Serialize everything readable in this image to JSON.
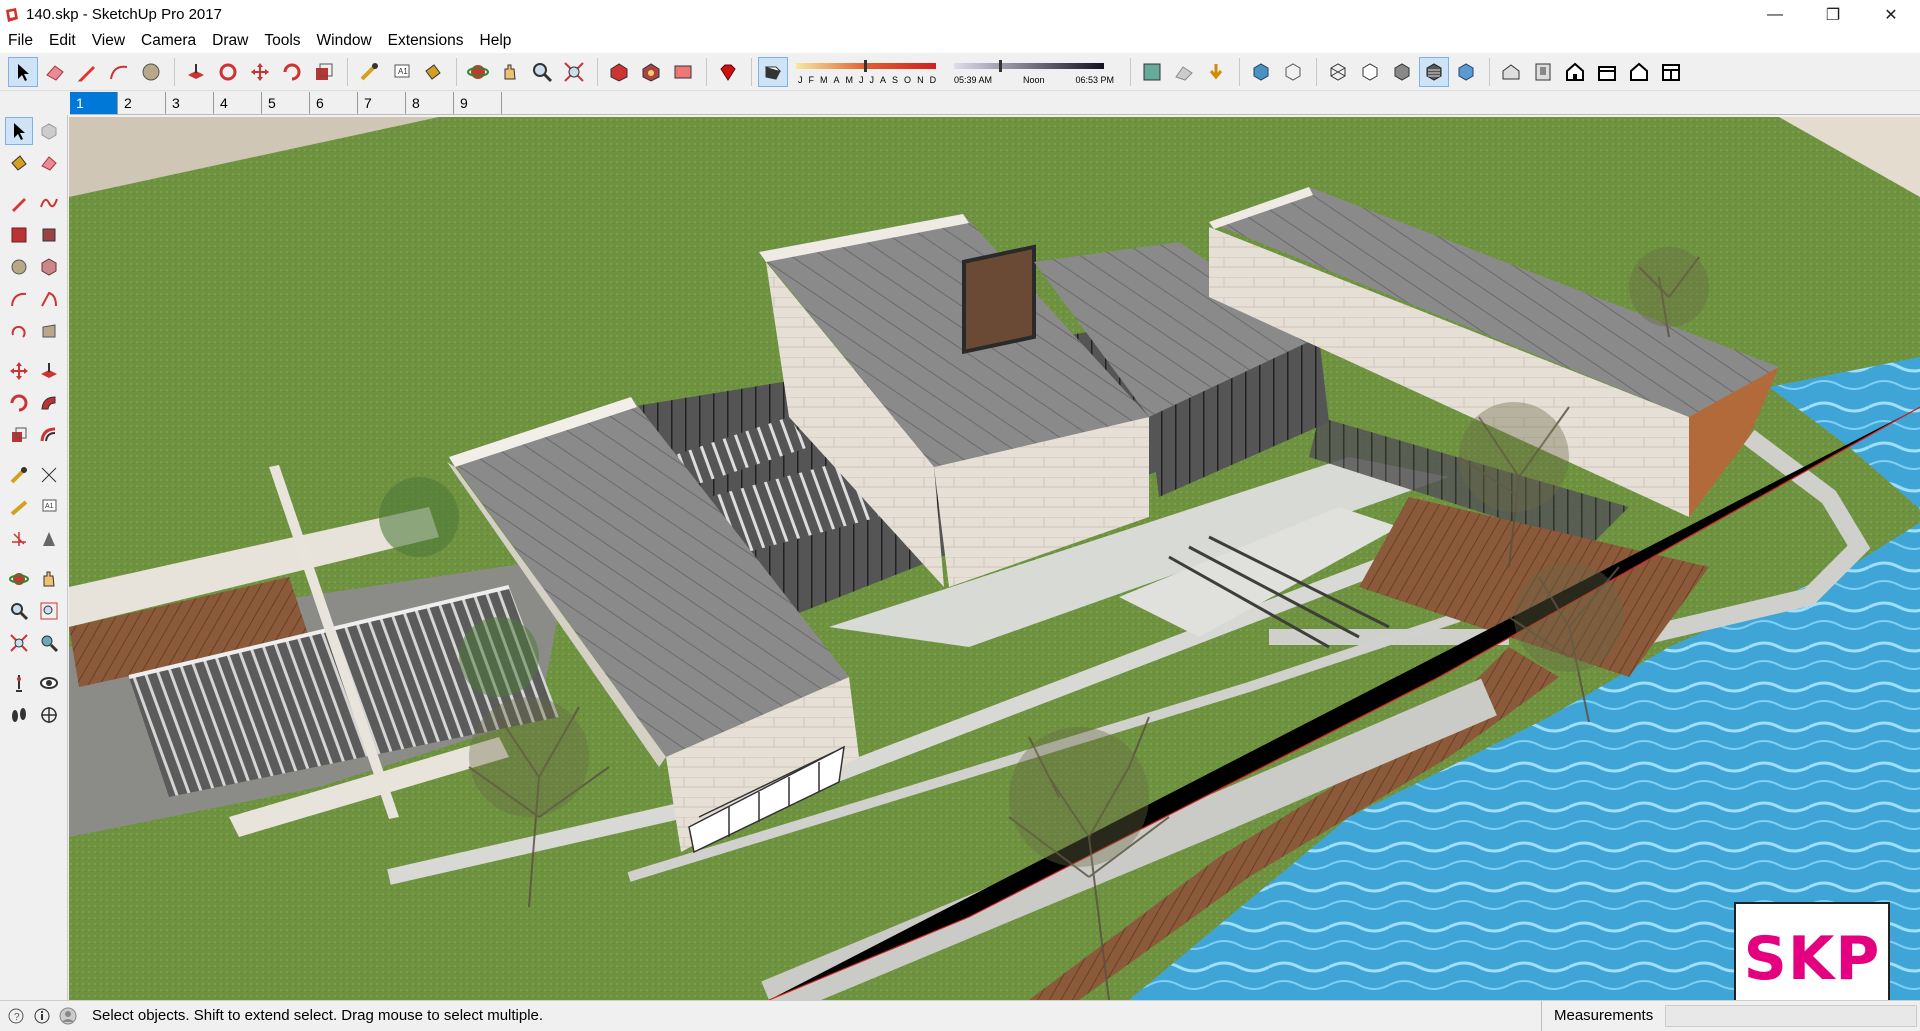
{
  "window": {
    "title": "140.skp - SketchUp Pro 2017",
    "minimize": "—",
    "maximize": "❐",
    "close": "✕"
  },
  "menu": [
    "File",
    "Edit",
    "View",
    "Camera",
    "Draw",
    "Tools",
    "Window",
    "Extensions",
    "Help"
  ],
  "shadows": {
    "months": [
      "J",
      "F",
      "M",
      "A",
      "M",
      "J",
      "J",
      "A",
      "S",
      "O",
      "N",
      "D"
    ],
    "time_start": "05:39 AM",
    "time_mid": "Noon",
    "time_end": "06:53 PM"
  },
  "scenes": [
    "1",
    "2",
    "3",
    "4",
    "5",
    "6",
    "7",
    "8",
    "9"
  ],
  "active_scene": "1",
  "status": {
    "message": "Select objects. Shift to extend select. Drag mouse to select multiple.",
    "measurements_label": "Measurements",
    "measurements_value": ""
  },
  "watermark": "SKP",
  "colors": {
    "accent": "#0078d7",
    "grass": "#6a8f3e",
    "water": "#3ba7d8",
    "logo": "#e4007f"
  }
}
